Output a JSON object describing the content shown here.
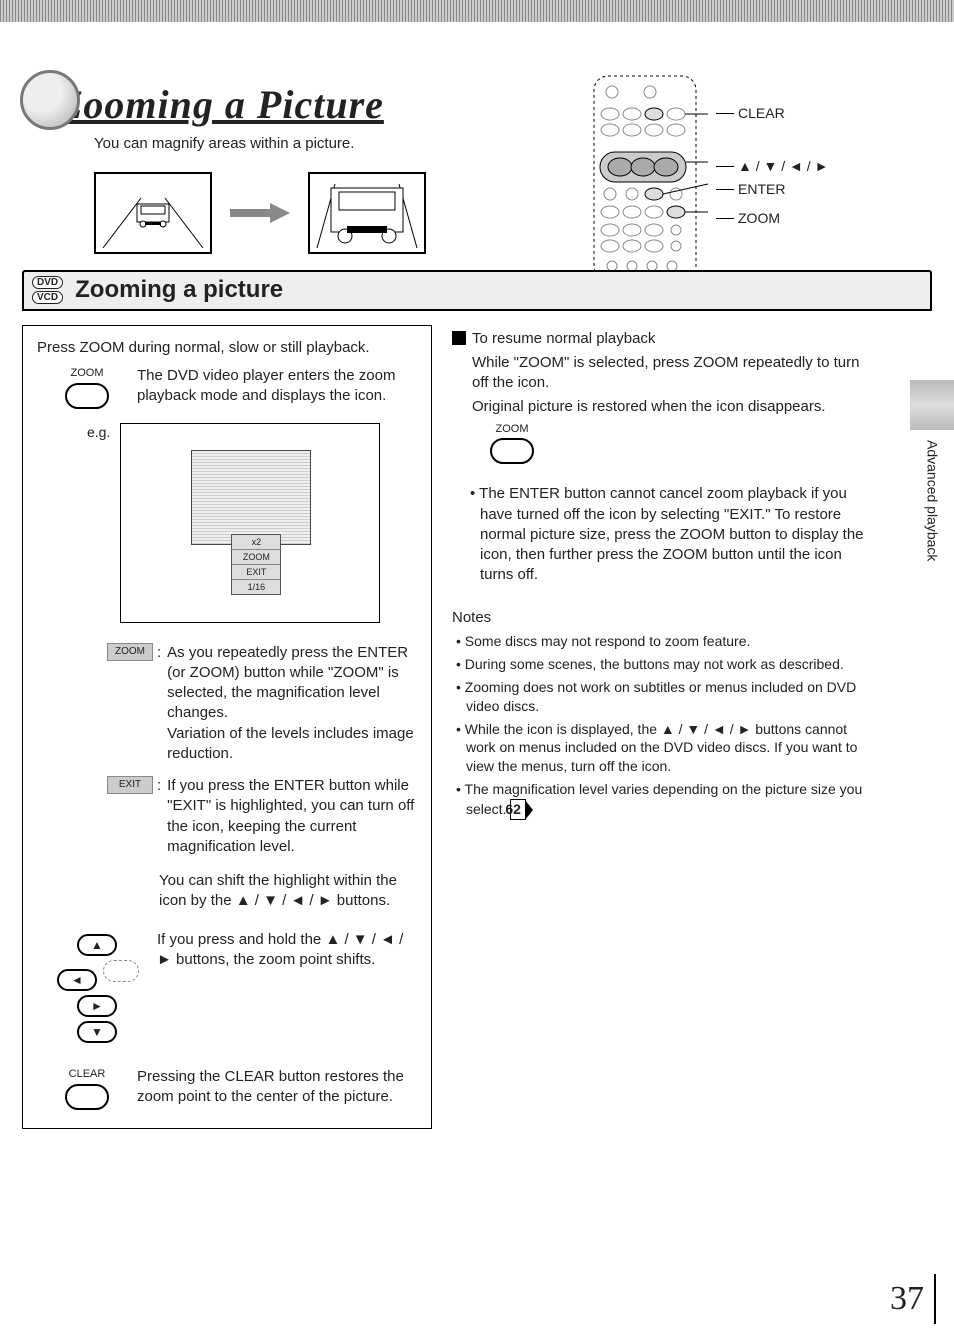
{
  "header": {
    "title": "Zooming a Picture",
    "subtitle": "You can magnify areas within a picture."
  },
  "remote_labels": {
    "clear": "CLEAR",
    "arrows": "▲ / ▼ / ◄ / ►",
    "enter": "ENTER",
    "zoom": "ZOOM"
  },
  "section": {
    "badge1": "DVD",
    "badge2": "VCD",
    "title": "Zooming a picture"
  },
  "left": {
    "intro": "Press ZOOM during normal, slow or still playback.",
    "zoom_btn_label": "ZOOM",
    "zoom_btn_text": "The DVD video player enters the zoom playback mode and displays the icon.",
    "eg_label": "e.g.",
    "zoom_menu_items": [
      "x2",
      "ZOOM",
      "EXIT",
      "1/16"
    ],
    "term_zoom_label": "ZOOM",
    "term_zoom_text": "As you repeatedly press the ENTER (or ZOOM) button while \"ZOOM\" is selected, the magnification level changes.",
    "term_zoom_text2": "Variation of the levels includes image reduction.",
    "term_exit_label": "EXIT",
    "term_exit_text": "If you press the ENTER button while \"EXIT\" is highlighted, you can turn off the icon, keeping the current magnification level.",
    "shift_text": "You can shift the highlight within the icon by the ▲ / ▼ / ◄ / ► buttons.",
    "hold_text": "If you press and hold the ▲ / ▼ / ◄ / ► buttons, the zoom point shifts.",
    "clear_btn_label": "CLEAR",
    "clear_text": "Pressing the CLEAR button restores the zoom point to the center of the picture."
  },
  "right": {
    "resume_title": "To resume normal playback",
    "resume_text1": "While \"ZOOM\" is selected, press ZOOM repeatedly to turn off the icon.",
    "resume_text2": "Original picture is restored when the icon disappears.",
    "zoom_btn_label": "ZOOM",
    "enter_note": "The ENTER button cannot cancel zoom playback if you have turned off the icon by selecting \"EXIT.\" To restore normal picture size, press the ZOOM button to display the icon, then further press the ZOOM button until the icon turns off.",
    "notes_title": "Notes",
    "notes": [
      "Some discs may not respond to zoom feature.",
      "During some scenes, the buttons may not work as described.",
      "Zooming does not work on subtitles or menus included on DVD video discs.",
      "While the icon is displayed, the ▲ / ▼ / ◄ / ► buttons cannot work on menus included on the DVD video discs. If you want to view the menus, turn off the icon.",
      "The magnification level varies depending on the picture size you select."
    ],
    "page_ref": "62"
  },
  "side_tab": "Advanced playback",
  "page_number": "37"
}
